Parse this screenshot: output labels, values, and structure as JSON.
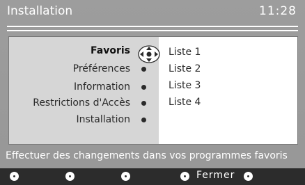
{
  "header": {
    "title": "Installation",
    "clock": "11:28"
  },
  "menu": {
    "items": [
      {
        "label": "Favoris",
        "active": true
      },
      {
        "label": "Préférences",
        "active": false
      },
      {
        "label": "Information",
        "active": false
      },
      {
        "label": "Restrictions d'Accès",
        "active": false
      },
      {
        "label": "Installation",
        "active": false
      }
    ]
  },
  "submenu": {
    "items": [
      "Liste 1",
      "Liste 2",
      "Liste 3",
      "Liste 4"
    ]
  },
  "help_text": "Effectuer des changements dans vos programmes favoris",
  "bottom": {
    "close_label": "Fermer"
  },
  "colors": {
    "background": "#9a9a9a",
    "panel_left": "#d6d6d6",
    "panel_right": "#ffffff",
    "bottom_bar": "#2c2c2c",
    "text": "#2a2a2a"
  }
}
